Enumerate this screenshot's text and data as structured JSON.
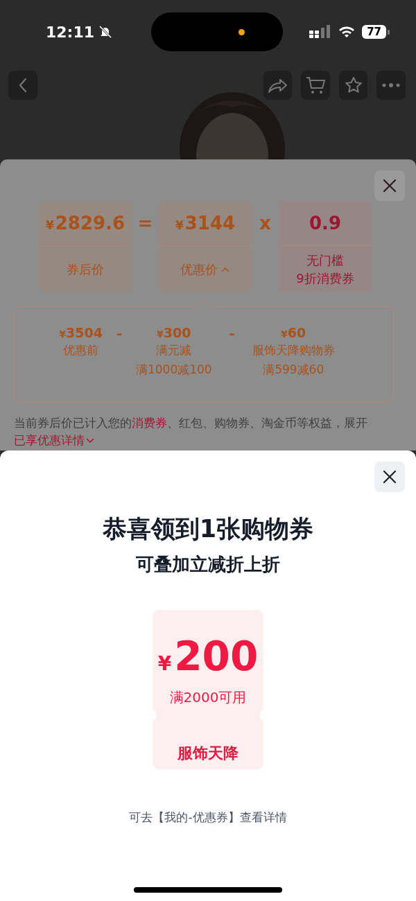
{
  "status_bar": {
    "time": "12:11",
    "silent": true,
    "battery": "77"
  },
  "price_formula": [
    {
      "kind": "price",
      "currency": "¥",
      "value": "2829.6",
      "label_lines": [
        "券后价"
      ],
      "color": "#a9521c"
    },
    {
      "kind": "operator",
      "symbol": "="
    },
    {
      "kind": "price",
      "currency": "¥",
      "value": "3144",
      "label_lines": [
        "优惠价"
      ],
      "color": "#a9521c",
      "expanded": true
    },
    {
      "kind": "operator",
      "symbol": "x"
    },
    {
      "kind": "price",
      "value": "0.9",
      "label_lines": [
        "无门槛",
        "9折消费券"
      ],
      "color": "#9c1531"
    }
  ],
  "breakdown": [
    {
      "kind": "item",
      "currency": "¥",
      "value": "3504",
      "lines": [
        "优惠前"
      ]
    },
    {
      "kind": "operator",
      "symbol": "-"
    },
    {
      "kind": "item",
      "currency": "¥",
      "value": "300",
      "lines": [
        "满元减",
        "满1000减100"
      ]
    },
    {
      "kind": "operator",
      "symbol": "-"
    },
    {
      "kind": "item",
      "currency": "¥",
      "value": "60",
      "lines": [
        "服饰天降购物券",
        "满599减60"
      ]
    }
  ],
  "note": [
    {
      "text": "当前券后价已计入您的",
      "highlight": false
    },
    {
      "text": "消费券",
      "highlight": true
    },
    {
      "text": "、红包、购物券、淘金币等权益，展开",
      "highlight": false
    }
  ],
  "details_link": "已享优惠详情",
  "coupon_dialog": {
    "title": "恭喜领到1张购物券",
    "subtitle": "可叠加立减折上折",
    "coupon": {
      "currency": "¥",
      "amount": "200",
      "condition": "满2000可用",
      "name": "服饰天降"
    },
    "footer": "可去【我的-优惠券】查看详情"
  }
}
